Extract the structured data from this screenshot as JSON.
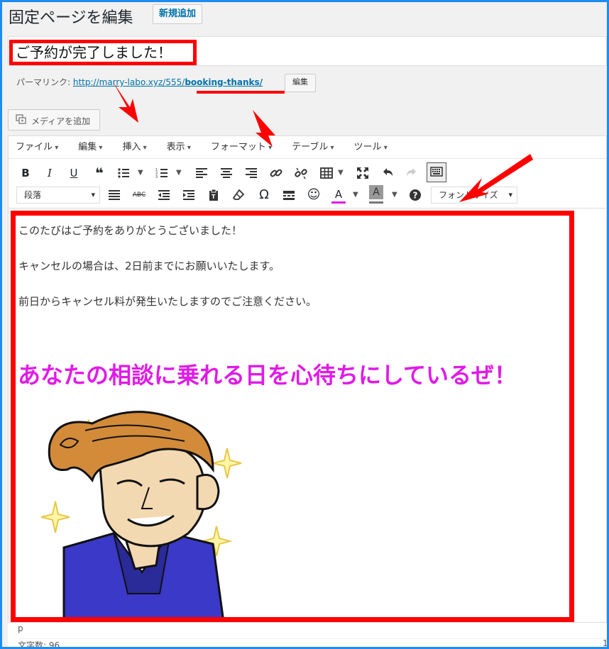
{
  "header": {
    "title": "固定ページを編集",
    "add_new": "新規追加"
  },
  "post": {
    "title": "ご予約が完了しました！"
  },
  "permalink": {
    "label": "パーマリンク:",
    "base_url": "http://marry-labo.xyz/555/",
    "slug": "booking-thanks/",
    "edit_button": "編集"
  },
  "media": {
    "button_label": "メディアを追加"
  },
  "menubar": {
    "items": [
      "ファイル",
      "編集",
      "挿入",
      "表示",
      "フォーマット",
      "テーブル",
      "ツール"
    ]
  },
  "toolbar": {
    "format_select": "段落",
    "font_size_select": "フォントサイズ",
    "text_color": "#e11ae8",
    "bg_color": "#777777"
  },
  "content": {
    "paragraphs": [
      "このたびはご予約をありがとうございました！",
      "キャンセルの場合は、2日前までにお願いいたします。",
      "前日からキャンセル料が発生いたしますのでご注意ください。"
    ],
    "highlight": "あなたの相談に乗れる日を心待ちにしているぜ！",
    "highlight_color": "#e11ae8"
  },
  "status": {
    "path": "p",
    "word_count": "文字数: 96",
    "right_fragment": "1"
  },
  "annotation_color": "#ff0000"
}
